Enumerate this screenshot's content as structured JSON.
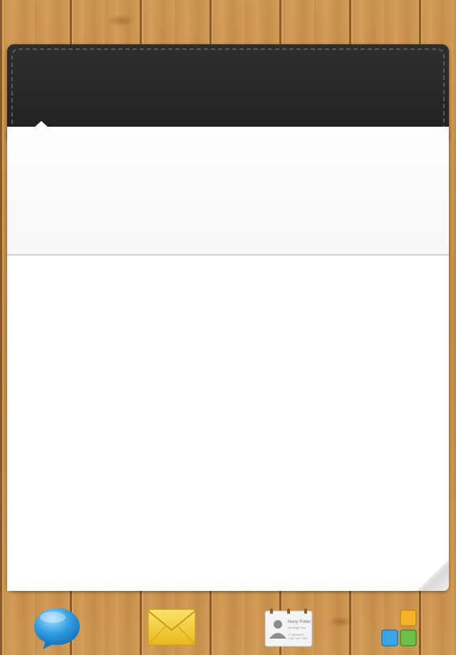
{
  "colors": {
    "wood": "#c58a45",
    "leather": "#262626",
    "paper": "#ffffff",
    "chat_blue": "#2d9be0",
    "mail_yellow": "#f2cf2a",
    "app_orange": "#f4b32a",
    "app_blue": "#3aa6e8",
    "app_green": "#6cc04a"
  },
  "dock": {
    "items": [
      {
        "icon": "chat-bubble-icon"
      },
      {
        "icon": "envelope-icon"
      },
      {
        "icon": "contact-card-icon"
      },
      {
        "icon": "app-grid-icon"
      }
    ]
  },
  "contact_card": {
    "name": "Harry Potter",
    "subtitle": "My Magic Boy",
    "line1": "07 86960827",
    "line2": "1 587 462 7951"
  }
}
